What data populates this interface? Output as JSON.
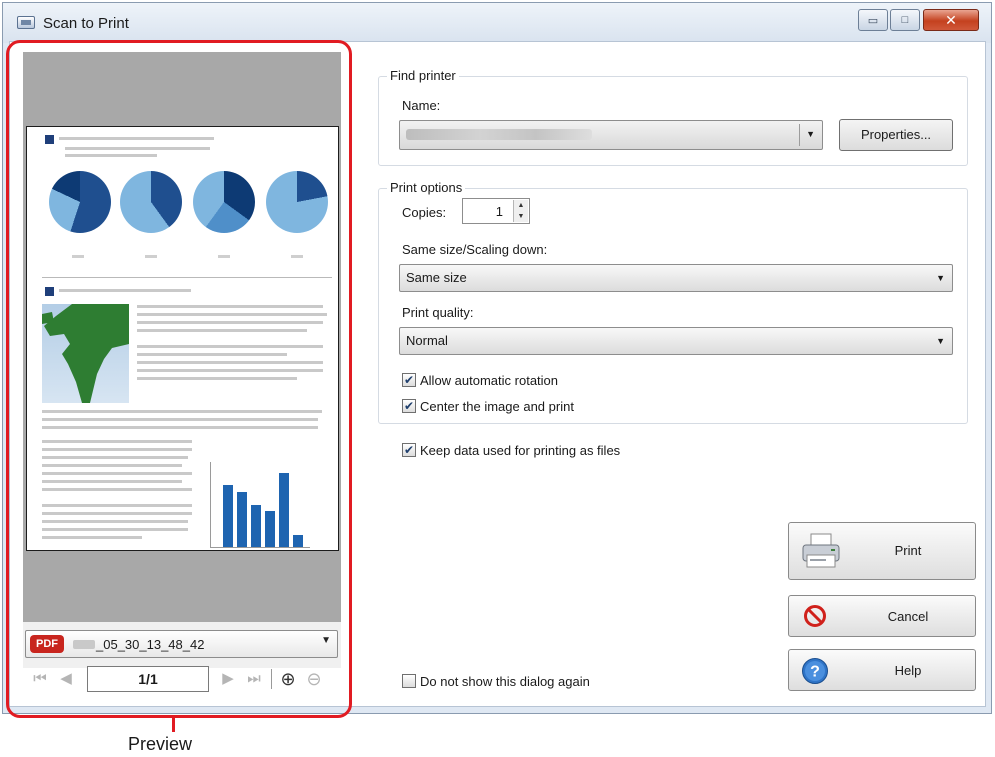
{
  "window": {
    "title": "Scan to Print",
    "minimize_glyph": "▭",
    "maximize_glyph": "□",
    "close_glyph": "✕"
  },
  "preview": {
    "file_badge": "PDF",
    "file_name": "_05_30_13_48_42",
    "file_dropdown_arrow": "▼",
    "page_indicator": "1/1",
    "nav_first": "⏮",
    "nav_prev": "◀",
    "nav_next": "▶",
    "nav_last": "⏭",
    "zoom_in": "⊕",
    "zoom_out": "⊖",
    "caption": "Preview"
  },
  "find_printer": {
    "group_title": "Find printer",
    "name_label": "Name:",
    "name_arrow": "▼",
    "properties_button": "Properties..."
  },
  "print_options": {
    "group_title": "Print options",
    "copies_label": "Copies:",
    "copies_value": "1",
    "spin_up": "▲",
    "spin_down": "▼",
    "scaling_label": "Same size/Scaling down:",
    "scaling_value": "Same size",
    "quality_label": "Print quality:",
    "quality_value": "Normal",
    "combo_arrow": "▼",
    "allow_rotation_label": "Allow automatic rotation",
    "allow_rotation_checked": true,
    "center_image_label": "Center the image and print",
    "center_image_checked": true
  },
  "keep_data": {
    "label": "Keep data used for printing as files",
    "checked": true
  },
  "do_not_show": {
    "label": "Do not show this dialog again",
    "checked": false
  },
  "buttons": {
    "print": "Print",
    "cancel": "Cancel",
    "help": "Help"
  },
  "colors": {
    "annotation_red": "#e11b22",
    "pdf_red": "#c8251e",
    "chart_blue": "#1e64b0",
    "pie_dark": "#1f4f8f",
    "pie_light": "#7fb6df",
    "map_green": "#2e7d32"
  }
}
